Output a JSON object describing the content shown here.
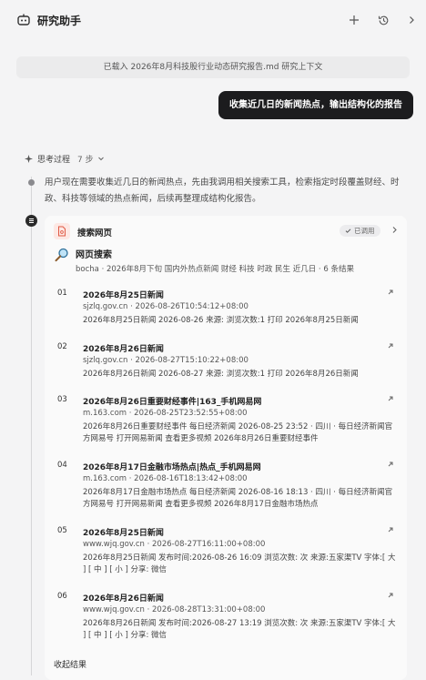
{
  "header": {
    "title": "研究助手",
    "add_icon": "plus-icon",
    "history_icon": "history-icon",
    "collapse_icon": "chevron-right-icon"
  },
  "context_banner": "已载入 2026年8月科技股行业动态研究报告.md 研究上下文",
  "user_message": "收集近几日的新闻热点，输出结构化的报告",
  "thinking": {
    "label": "思考过程",
    "count": "7 步",
    "text": "用户现在需要收集近几日的新闻热点，先由我调用相关搜索工具，检索指定时段覆盖财经、时政、科技等领域的热点新闻，后续再整理成结构化报告。"
  },
  "tool_card": {
    "title": "搜索网页",
    "status": "已调用",
    "search_title": "网页搜索",
    "search_meta": "bocha · 2026年8月下旬 国内外热点新闻 财经 科技 时政 民生 近几日 · 6 条结果",
    "results": [
      {
        "num": "01",
        "title": "2026年8月25日新闻",
        "meta": "sjzlq.gov.cn · 2026-08-26T10:54:12+08:00",
        "snippet": "2026年8月25日新闻 2026-08-26 来源: 浏览次数:1 打印 2026年8月25日新闻"
      },
      {
        "num": "02",
        "title": "2026年8月26日新闻",
        "meta": "sjzlq.gov.cn · 2026-08-27T15:10:22+08:00",
        "snippet": "2026年8月26日新闻 2026-08-27 来源: 浏览次数:1 打印 2026年8月26日新闻"
      },
      {
        "num": "03",
        "title": "2026年8月26日重要财经事件|163_手机网易网",
        "meta": "m.163.com · 2026-08-25T23:52:55+08:00",
        "snippet": "2026年8月26日重要财经事件 每日经济新闻 2026-08-25 23:52 · 四川 · 每日经济新闻官方网易号 打开网易新闻 查看更多视频 2026年8月26日重要财经事件"
      },
      {
        "num": "04",
        "title": "2026年8月17日金融市场热点|热点_手机网易网",
        "meta": "m.163.com · 2026-08-16T18:13:42+08:00",
        "snippet": "2026年8月17日金融市场热点 每日经济新闻 2026-08-16 18:13 · 四川 · 每日经济新闻官方网易号 打开网易新闻 查看更多视频 2026年8月17日金融市场热点"
      },
      {
        "num": "05",
        "title": "2026年8月25日新闻",
        "meta": "www.wjq.gov.cn · 2026-08-27T16:11:00+08:00",
        "snippet": "2026年8月25日新闻 发布时间:2026-08-26 16:09 浏览次数: 次 来源:五家渠TV 字体:[ 大 ] [ 中 ] [ 小 ] 分享: 微信"
      },
      {
        "num": "06",
        "title": "2026年8月26日新闻",
        "meta": "www.wjq.gov.cn · 2026-08-28T13:31:00+08:00",
        "snippet": "2026年8月26日新闻 发布时间:2026-08-27 13:19 浏览次数: 次 来源:五家渠TV 字体:[ 大 ] [ 中 ] [ 小 ] 分享: 微信"
      }
    ],
    "more_label": "收起结果"
  }
}
